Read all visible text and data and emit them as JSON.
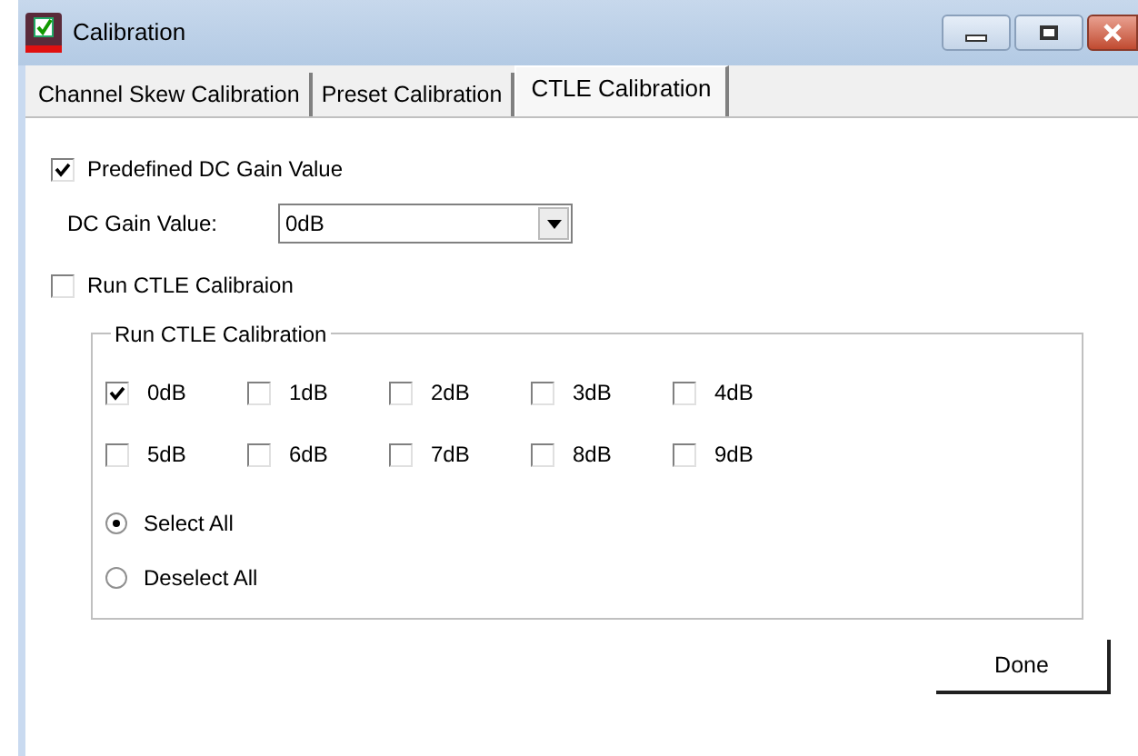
{
  "window": {
    "title": "Calibration"
  },
  "tabs": [
    {
      "label": "Channel Skew Calibration",
      "selected": false
    },
    {
      "label": "Preset Calibration",
      "selected": false
    },
    {
      "label": "CTLE Calibration",
      "selected": true
    }
  ],
  "predefined": {
    "label": "Predefined DC Gain Value",
    "checked": true
  },
  "dc_gain": {
    "label": "DC Gain Value:",
    "value": "0dB"
  },
  "run_ctle": {
    "label": "Run CTLE Calibraion",
    "checked": false
  },
  "group": {
    "title": "Run CTLE Calibration",
    "gains": [
      {
        "label": "0dB",
        "checked": true
      },
      {
        "label": "1dB",
        "checked": false
      },
      {
        "label": "2dB",
        "checked": false
      },
      {
        "label": "3dB",
        "checked": false
      },
      {
        "label": "4dB",
        "checked": false
      },
      {
        "label": "5dB",
        "checked": false
      },
      {
        "label": "6dB",
        "checked": false
      },
      {
        "label": "7dB",
        "checked": false
      },
      {
        "label": "8dB",
        "checked": false
      },
      {
        "label": "9dB",
        "checked": false
      }
    ],
    "options": [
      {
        "label": "Select All",
        "selected": true
      },
      {
        "label": "Deselect All",
        "selected": false
      }
    ]
  },
  "buttons": [
    "Done"
  ]
}
